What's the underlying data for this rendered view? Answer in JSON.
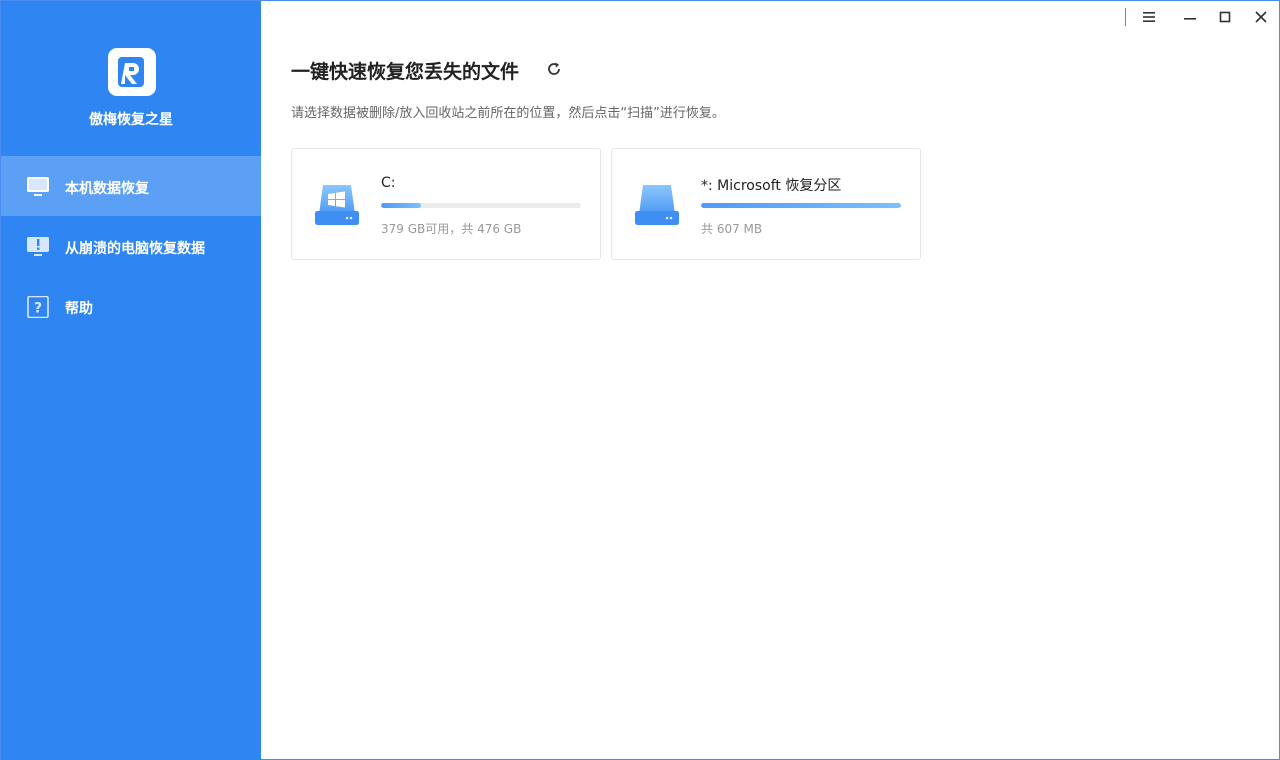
{
  "app": {
    "name": "傲梅恢复之星"
  },
  "sidebar": {
    "items": [
      {
        "label": "本机数据恢复",
        "active": true,
        "icon": "monitor-icon"
      },
      {
        "label": "从崩溃的电脑恢复数据",
        "active": false,
        "icon": "crashed-pc-icon"
      },
      {
        "label": "帮助",
        "active": false,
        "icon": "help-icon"
      }
    ]
  },
  "window_controls": [
    "menu-icon",
    "minimize-icon",
    "maximize-icon",
    "close-icon"
  ],
  "main": {
    "title": "一键快速恢复您丢失的文件",
    "subtitle": "请选择数据被删除/放入回收站之前所在的位置，然后点击“扫描”进行恢复。",
    "drives": [
      {
        "name": "C:",
        "info": "379 GB可用，共 476 GB",
        "used_fraction": 0.2,
        "icon": "windows-disk-icon"
      },
      {
        "name": "*: Microsoft 恢复分区",
        "info": "共 607 MB",
        "used_fraction": 1.0,
        "icon": "disk-icon"
      }
    ]
  },
  "colors": {
    "sidebar": "#2f86f3",
    "accent": "#4f9af5"
  }
}
